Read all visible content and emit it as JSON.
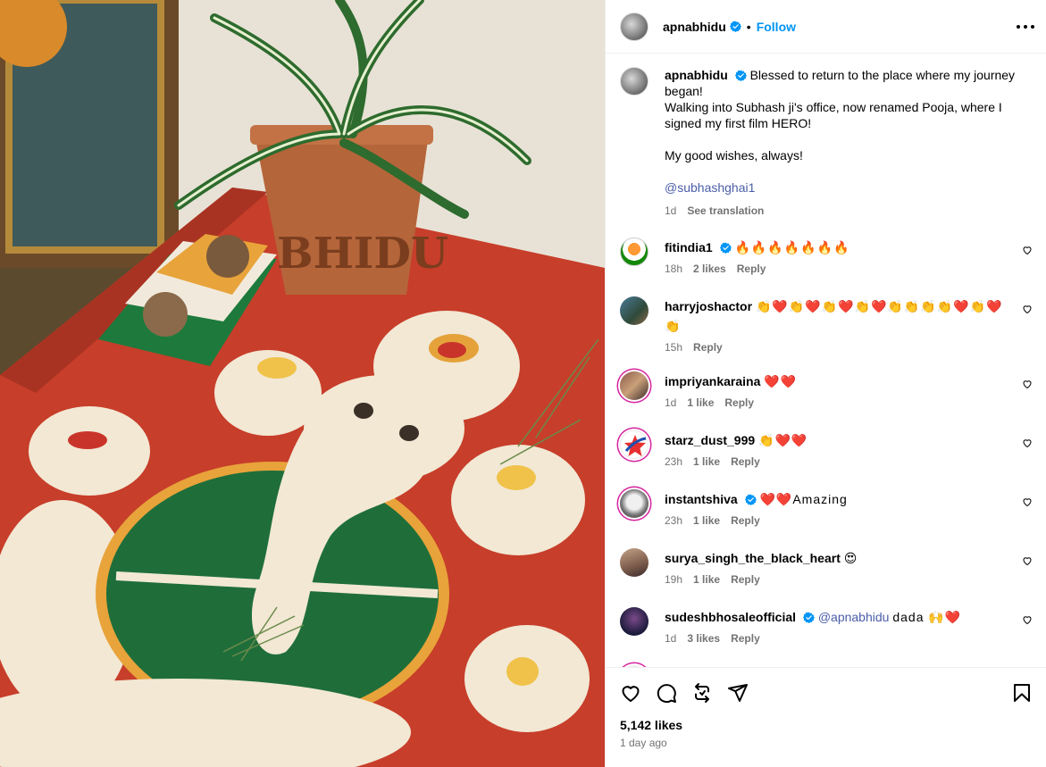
{
  "post": {
    "username": "apnabhidu",
    "follow_label": "Follow",
    "separator": "•",
    "caption": {
      "line1": "Blessed to return to the place where my journey began!",
      "line2": "Walking into Subhash ji's office, now renamed Pooja, where I signed my first film HERO!",
      "line3": "My good wishes, always!",
      "mention": "@subhashghai1",
      "time": "1d",
      "see_translation": "See translation"
    }
  },
  "comments": [
    {
      "username": "fitindia1",
      "verified": true,
      "text": "🔥🔥🔥🔥🔥🔥🔥",
      "time": "18h",
      "likes": "2 likes",
      "reply": "Reply"
    },
    {
      "username": "harryjoshactor",
      "verified": false,
      "text": "👏❤️👏❤️👏❤️👏❤️👏👏👏👏❤️👏❤️👏",
      "time": "15h",
      "likes": "",
      "reply": "Reply"
    },
    {
      "username": "impriyankaraina",
      "verified": false,
      "text": "❤️❤️",
      "time": "1d",
      "likes": "1 like",
      "reply": "Reply"
    },
    {
      "username": "starz_dust_999",
      "verified": false,
      "text": "👏❤️❤️",
      "time": "23h",
      "likes": "1 like",
      "reply": "Reply"
    },
    {
      "username": "instantshiva",
      "verified": true,
      "text": "❤️❤️Amazing",
      "time": "23h",
      "likes": "1 like",
      "reply": "Reply"
    },
    {
      "username": "surya_singh_the_black_heart",
      "verified": false,
      "text": "😍",
      "time": "19h",
      "likes": "1 like",
      "reply": "Reply"
    },
    {
      "username": "sudeshbhosaleofficial",
      "verified": true,
      "mention": "@apnabhidu",
      "text": "dada 🙌❤️",
      "time": "1d",
      "likes": "3 likes",
      "reply": "Reply"
    }
  ],
  "footer": {
    "likes": "5,142 likes",
    "time_ago": "1 day ago"
  },
  "colors": {
    "accent": "#0095f6",
    "verified": "#0095f6",
    "mention": "#4a5da8",
    "secondary_text": "#737373",
    "border": "#efefef"
  },
  "icons": [
    "verified-badge-icon",
    "more-options-icon",
    "heart-icon",
    "comment-icon",
    "share-icon",
    "send-icon",
    "bookmark-icon"
  ]
}
